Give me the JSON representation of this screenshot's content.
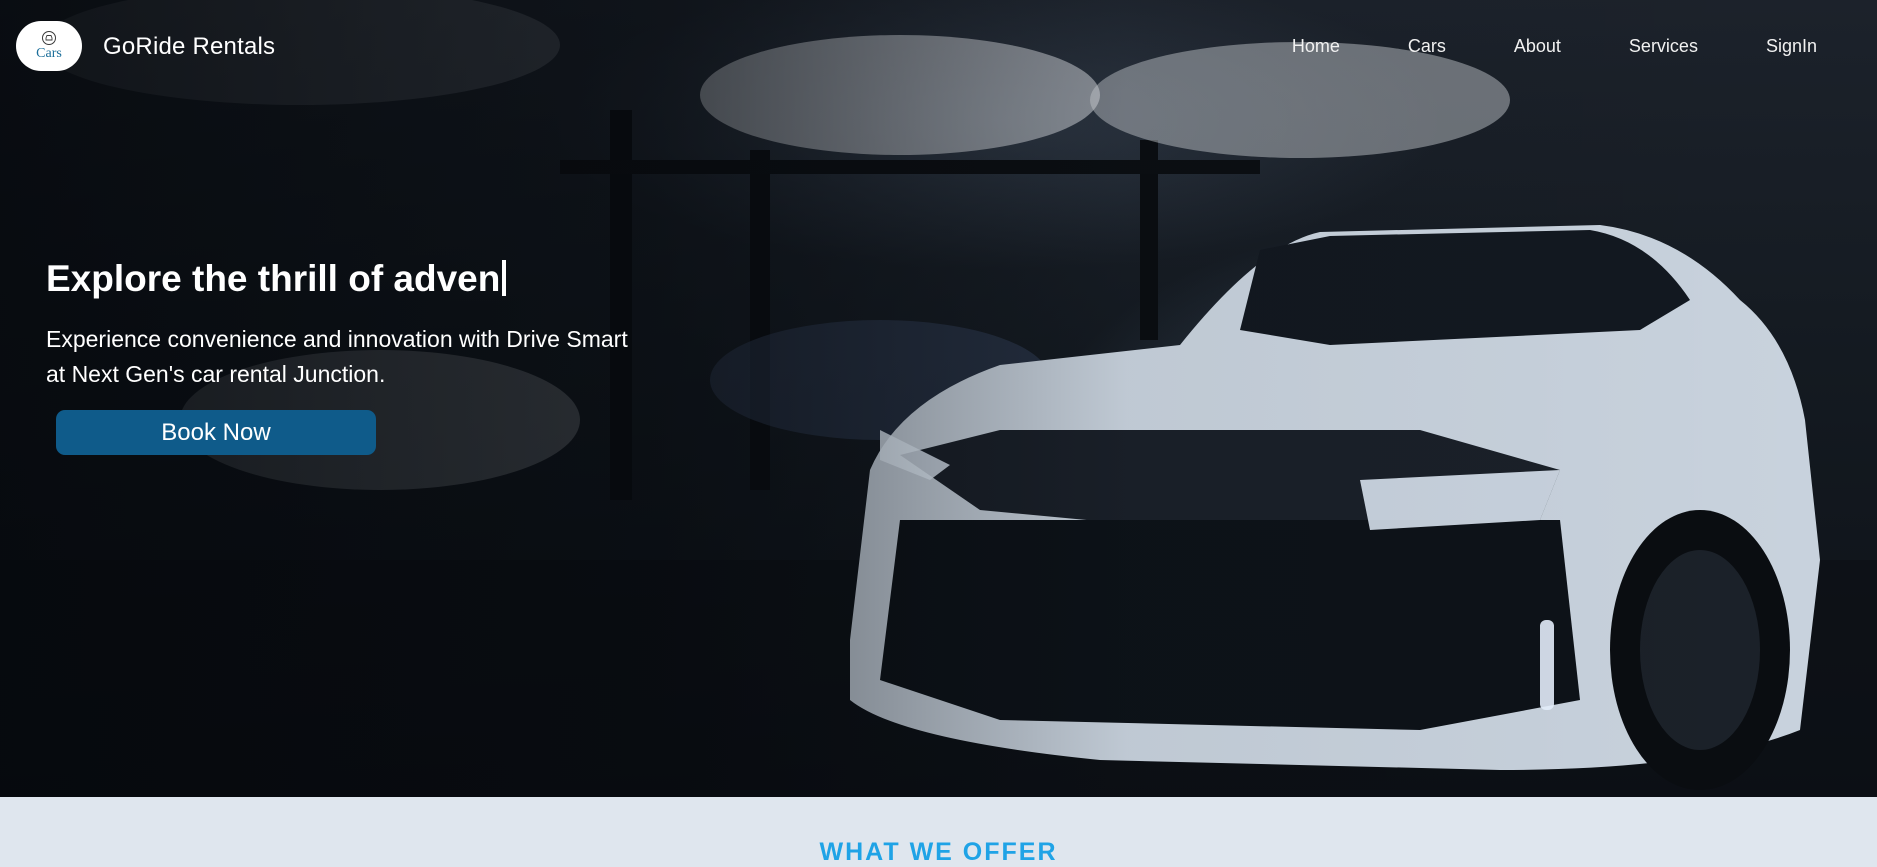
{
  "brand": {
    "logo_text": "Cars",
    "logo_icon": "car-icon",
    "name": "GoRide Rentals"
  },
  "nav": {
    "items": [
      {
        "label": "Home"
      },
      {
        "label": "Cars"
      },
      {
        "label": "About"
      },
      {
        "label": "Services"
      },
      {
        "label": "SignIn"
      }
    ]
  },
  "hero": {
    "title": "Explore the thrill of adven",
    "subtitle": "Experience convenience and innovation with Drive Smart at Next Gen's car rental Junction.",
    "cta_label": "Book Now"
  },
  "offer": {
    "heading": "WHAT WE OFFER"
  },
  "colors": {
    "accent": "#0f5b8a",
    "heading_blue": "#1fa3e6",
    "section_bg": "#dfe6ee"
  }
}
